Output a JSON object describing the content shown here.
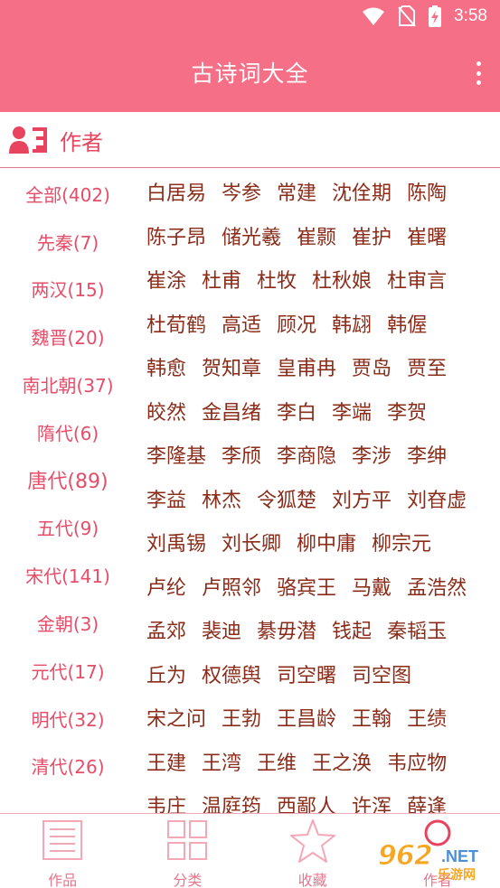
{
  "status_bar": {
    "time": "3:58",
    "icons": [
      "wifi-icon",
      "no-sim-icon",
      "battery-charging-icon"
    ]
  },
  "app_bar": {
    "title": "古诗词大全",
    "menu_icon": "more-vert-icon"
  },
  "section": {
    "title": "作者",
    "icon": "author-list-icon"
  },
  "colors": {
    "primary": "#f56f86",
    "dynasty_text": "#e64d68",
    "poet_text": "#8a2c19",
    "nav_text": "#e8758d"
  },
  "dynasties": [
    {
      "label": "全部(402)",
      "active": false
    },
    {
      "label": "先秦(7)",
      "active": false
    },
    {
      "label": "两汉(15)",
      "active": false
    },
    {
      "label": "魏晋(20)",
      "active": false
    },
    {
      "label": "南北朝(37)",
      "active": false
    },
    {
      "label": "隋代(6)",
      "active": false
    },
    {
      "label": "唐代(89)",
      "active": true
    },
    {
      "label": "五代(9)",
      "active": false
    },
    {
      "label": "宋代(141)",
      "active": false
    },
    {
      "label": "金朝(3)",
      "active": false
    },
    {
      "label": "元代(17)",
      "active": false
    },
    {
      "label": "明代(32)",
      "active": false
    },
    {
      "label": "清代(26)",
      "active": false
    }
  ],
  "poet_rows": [
    [
      "白居易",
      "岑参",
      "常建",
      "沈佺期",
      "陈陶"
    ],
    [
      "陈子昂",
      "储光羲",
      "崔颢",
      "崔护",
      "崔曙"
    ],
    [
      "崔涂",
      "杜甫",
      "杜牧",
      "杜秋娘",
      "杜审言"
    ],
    [
      "杜荀鹤",
      "高适",
      "顾况",
      "韩翃",
      "韩偓"
    ],
    [
      "韩愈",
      "贺知章",
      "皇甫冉",
      "贾岛",
      "贾至"
    ],
    [
      "皎然",
      "金昌绪",
      "李白",
      "李端",
      "李贺"
    ],
    [
      "李隆基",
      "李颀",
      "李商隐",
      "李涉",
      "李绅"
    ],
    [
      "李益",
      "林杰",
      "令狐楚",
      "刘方平",
      "刘昚虚"
    ],
    [
      "刘禹锡",
      "刘长卿",
      "柳中庸",
      "柳宗元"
    ],
    [
      "卢纶",
      "卢照邻",
      "骆宾王",
      "马戴",
      "孟浩然"
    ],
    [
      "孟郊",
      "裴迪",
      "綦毋潜",
      "钱起",
      "秦韬玉"
    ],
    [
      "丘为",
      "权德舆",
      "司空曙",
      "司空图"
    ],
    [
      "宋之问",
      "王勃",
      "王昌龄",
      "王翰",
      "王绩"
    ],
    [
      "王建",
      "王湾",
      "王维",
      "王之涣",
      "韦应物"
    ],
    [
      "韦庄",
      "温庭筠",
      "西鄙人",
      "许浑",
      "薛逢"
    ]
  ],
  "bottom_nav": [
    {
      "label": "作品",
      "icon": "document-icon"
    },
    {
      "label": "分类",
      "icon": "grid-icon"
    },
    {
      "label": "收藏",
      "icon": "star-icon"
    },
    {
      "label": "作者",
      "icon": "author-icon"
    }
  ],
  "watermark": {
    "text": "962",
    "suffix": ".NET",
    "sub": "乐游网"
  }
}
